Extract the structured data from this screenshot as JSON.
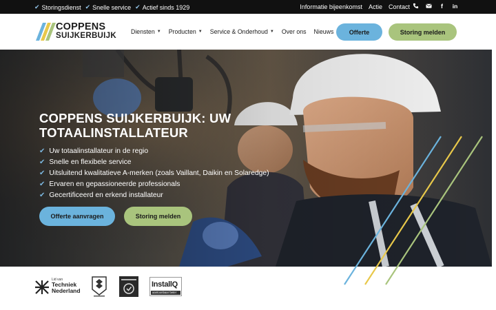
{
  "topbar": {
    "usps": [
      "Storingsdienst",
      "Snelle service",
      "Actief sinds 1929"
    ],
    "links": [
      "Informatie bijeenkomst",
      "Actie",
      "Contact"
    ],
    "social_icons": [
      "phone-icon",
      "mail-icon",
      "facebook-icon",
      "linkedin-icon"
    ]
  },
  "header": {
    "logo": {
      "line1": "COPPENS",
      "line2": "SUIJKERBUIJK"
    },
    "nav": [
      {
        "label": "Diensten",
        "dropdown": true
      },
      {
        "label": "Producten",
        "dropdown": true
      },
      {
        "label": "Service & Onderhoud",
        "dropdown": true
      },
      {
        "label": "Over ons",
        "dropdown": false
      },
      {
        "label": "Nieuws",
        "dropdown": false
      }
    ],
    "btn_offerte": "Offerte",
    "btn_storing": "Storing melden"
  },
  "hero": {
    "title": "COPPENS SUIJKERBUIJK: UW TOTAALINSTALLATEUR",
    "bullets": [
      "Uw totaalinstallateur in de regio",
      "Snelle en flexibele service",
      "Uitsluitend kwalitatieve A-merken (zoals Vaillant, Daikin en Solaredge)",
      "Ervaren en gepassioneerde professionals",
      "Gecertificeerd en erkend installateur"
    ],
    "btn_offerte": "Offerte aanvragen",
    "btn_storing": "Storing melden"
  },
  "certs": {
    "techniek": {
      "line1": "Lid van",
      "line2": "Techniek",
      "line3": "Nederland"
    },
    "installq": {
      "name": "InstallQ",
      "tagline": "aantoonbaar beter"
    }
  },
  "colors": {
    "blue": "#6bb3dd",
    "green": "#a9c47d",
    "yellow": "#e8c84a",
    "dark": "#111111"
  }
}
